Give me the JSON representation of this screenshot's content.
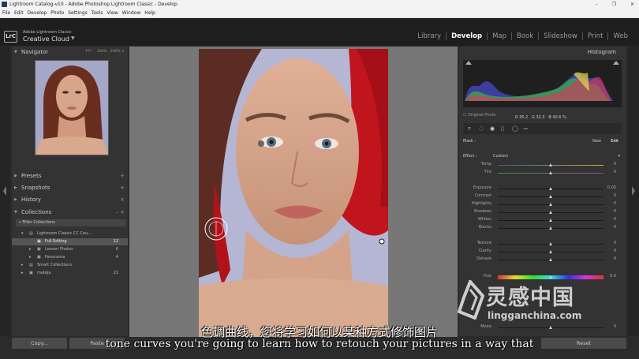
{
  "window": {
    "title": "Lightroom Catalog-v10 - Adobe Photoshop Lightroom Classic - Develop",
    "controls": [
      "–",
      "❐",
      "✕"
    ]
  },
  "menu": [
    "File",
    "Edit",
    "Develop",
    "Photo",
    "Settings",
    "Tools",
    "View",
    "Window",
    "Help"
  ],
  "identity": {
    "logo": "LrC",
    "product_small": "Adobe Lightroom Classic",
    "product_big": "Creative Cloud",
    "caret": "▼"
  },
  "modules": [
    "Library",
    "Develop",
    "Map",
    "Book",
    "Slideshow",
    "Print",
    "Web"
  ],
  "active_module": "Develop",
  "left": {
    "navigator": "Navigator",
    "zoom": [
      "FIT :",
      "100%",
      "200% ↕"
    ],
    "presets": "Presets",
    "snapshots": "Snapshots",
    "history": "History",
    "collections": "Collections",
    "collections_ctrl": "– +",
    "filter": "Filter Collections",
    "items": [
      {
        "label": "Lightroom Classic CC Cou...",
        "count": ""
      },
      {
        "label": "Full Editing",
        "count": "12"
      },
      {
        "label": "Lesson Photos",
        "count": "6"
      },
      {
        "label": "Panorama",
        "count": "4"
      },
      {
        "label": "Smart Collections",
        "count": ""
      },
      {
        "label": "mateja",
        "count": "21"
      }
    ],
    "copy": "Copy...",
    "paste": "Paste"
  },
  "right": {
    "histogram": "Histogram",
    "rgb": {
      "r_label": "R",
      "r": "35.2",
      "g_label": "G",
      "g": "32.3",
      "b_label": "B",
      "b": "40.6",
      "unit": "%"
    },
    "original_photo": "Original Photo",
    "mask": "Mask :",
    "new": "New",
    "edit": "Edit",
    "effect": "Effect :",
    "effect_value": "Custom",
    "sliders": [
      {
        "label": "Temp",
        "pos": 0.5,
        "value": "0"
      },
      {
        "label": "Tint",
        "pos": 0.5,
        "value": "0"
      },
      {
        "label": "Exposure",
        "pos": 0.5,
        "value": "0.00"
      },
      {
        "label": "Contrast",
        "pos": 0.5,
        "value": "0"
      },
      {
        "label": "Highlights",
        "pos": 0.5,
        "value": "0"
      },
      {
        "label": "Shadows",
        "pos": 0.5,
        "value": "0"
      },
      {
        "label": "Whites",
        "pos": 0.5,
        "value": "0"
      },
      {
        "label": "Blacks",
        "pos": 0.5,
        "value": "0"
      },
      {
        "label": "Texture",
        "pos": 0.5,
        "value": "0"
      },
      {
        "label": "Clarity",
        "pos": 0.5,
        "value": "0"
      },
      {
        "label": "Dehaze",
        "pos": 0.5,
        "value": "0"
      },
      {
        "label": "Hue",
        "pos": 0.5,
        "value": "0.0"
      },
      {
        "label": "Moire",
        "pos": 0.5,
        "value": "0"
      }
    ],
    "reset": "Reset"
  },
  "subtitles": {
    "cn": "色调曲线，您将学习如何以某种方式修饰图片",
    "en": "tone curves you're going to learn how to retouch your pictures in a way that"
  },
  "watermark": {
    "big": "灵感中国",
    "small": "lingganchina.com"
  }
}
